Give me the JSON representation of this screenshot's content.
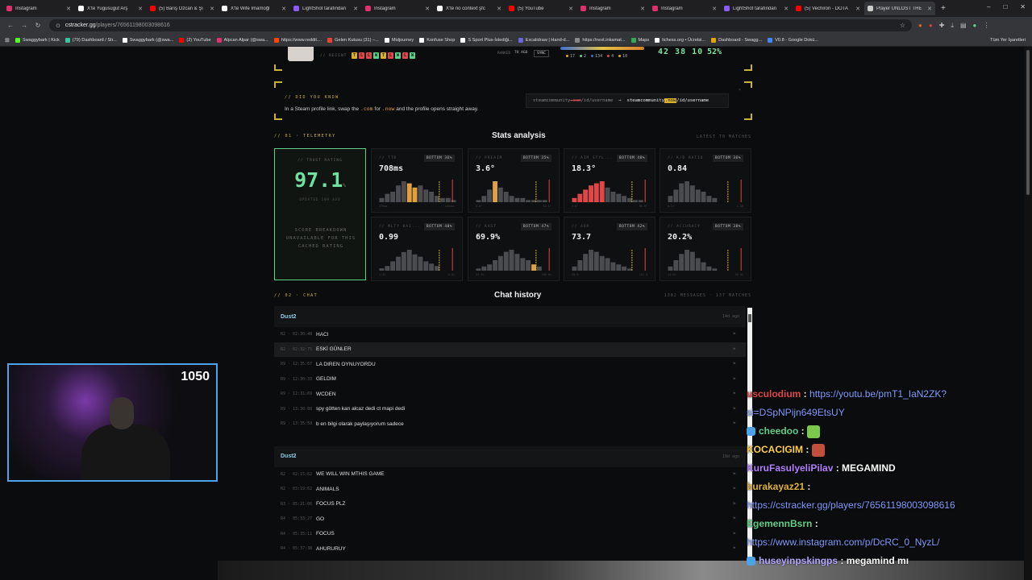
{
  "tabs": [
    {
      "title": "Instagram",
      "color": "#e1306c"
    },
    {
      "title": "X'te Yugusugut Arş",
      "color": "#ffffff"
    },
    {
      "title": "(5) Barış Özcan & Şi",
      "color": "#ff0000"
    },
    {
      "title": "X'te Wife İmamoğl",
      "color": "#ffffff"
    },
    {
      "title": "LightShot tarafından",
      "color": "#8a5cf5"
    },
    {
      "title": "Instagram",
      "color": "#e1306c"
    },
    {
      "title": "X'te no context şfc",
      "color": "#ffffff"
    },
    {
      "title": "(5) YouTube",
      "color": "#ff0000"
    },
    {
      "title": "Instagram",
      "color": "#e1306c"
    },
    {
      "title": "Instagram",
      "color": "#e1306c"
    },
    {
      "title": "LightShot tarafından",
      "color": "#8a5cf5"
    },
    {
      "title": "(5) Vechiron - DOTA",
      "color": "#ff0000"
    },
    {
      "title": "Player UNLOST THE",
      "color": "#cccccc"
    }
  ],
  "window_controls": [
    "–",
    "□",
    "✕"
  ],
  "nav": {
    "back": "←",
    "forward": "→",
    "reload": "↻",
    "lock": "⊙"
  },
  "url": {
    "host": "cstracker.gg",
    "path": "/players/76561198003098616"
  },
  "bookmarks": [
    {
      "label": "Swaggybark | Kick",
      "color": "#53fc18"
    },
    {
      "label": "(79) Dashboard / Str...",
      "color": "#36c5a0"
    },
    {
      "label": "Swaggybark (@swa...",
      "color": "#ffffff"
    },
    {
      "label": "(2) YouTube",
      "color": "#ff0000"
    },
    {
      "label": "Alpcan Alpar (@swa...",
      "color": "#e1306c"
    },
    {
      "label": "https://www.reddit....",
      "color": "#ff4500"
    },
    {
      "label": "Gelen Kutusu (31) –...",
      "color": "#ea4335"
    },
    {
      "label": "Midjourney",
      "color": "#ffffff"
    },
    {
      "label": "Konfuse Shop",
      "color": "#ffffff"
    },
    {
      "label": "S Sport Plus-İstediği...",
      "color": "#ffffff"
    },
    {
      "label": "Excalidraw | Hand-d...",
      "color": "#6965db"
    },
    {
      "label": "https://next.inkamat...",
      "color": "#888888"
    },
    {
      "label": "Maps",
      "color": "#34a853"
    },
    {
      "label": "lichess.org • Ücretsi...",
      "color": "#ffffff"
    },
    {
      "label": "Dashboard - Swagg...",
      "color": "#e2a400"
    },
    {
      "label": "V0.8 - Google Dokü...",
      "color": "#4285f4"
    }
  ],
  "bookmarks_right": "Tüm Yer İşaretleri",
  "profile": {
    "recent_label": "// RECENT",
    "recent": [
      {
        "r": "T",
        "c": "#d9b02a"
      },
      {
        "r": "L",
        "c": "#e04848"
      },
      {
        "r": "L",
        "c": "#e04848"
      },
      {
        "r": "W",
        "c": "#5fd08a"
      },
      {
        "r": "T",
        "c": "#d9b02a"
      },
      {
        "r": "L",
        "c": "#e04848"
      },
      {
        "r": "W",
        "c": "#5fd08a"
      },
      {
        "r": "L",
        "c": "#e04848"
      },
      {
        "r": "W",
        "c": "#5fd08a"
      }
    ],
    "ranked": "RANKED",
    "ago": "7H AGO",
    "sync": "SYNC",
    "map_stats": [
      {
        "v": "17",
        "c": "#d9b02a"
      },
      {
        "v": "2",
        "c": "#5fd08a"
      },
      {
        "v": "134",
        "c": "#3e6fd1"
      },
      {
        "v": "4",
        "c": "#e04848"
      },
      {
        "v": "10",
        "c": "#d9b02a"
      }
    ],
    "kda": "42 38 10",
    "winrate": "52%"
  },
  "did_you_know": {
    "label": "// DID YOU KNOW",
    "text_a": "In a Steam profile link, swap the ",
    "com": ".com",
    "text_b": " for ",
    "now": ".now",
    "text_c": " and the profile opens straight away.",
    "from_a": "steamcommunity",
    "from_b": ".com",
    "from_c": "/id/username",
    "arrow": "→",
    "to_a": "steamcommunity",
    "to_b": ".now",
    "to_c": "/id/username",
    "close": "×"
  },
  "telemetry": {
    "label": "// 01 · TELEMETRY",
    "title": "Stats analysis",
    "right": "LATEST 70 MATCHES"
  },
  "trust": {
    "label": "// TRUST RATING",
    "value": "97.1",
    "unit": "%",
    "updated": "UPDATED 10H AGO",
    "note": "SCORE BREAKDOWN UNAVAILABLE FOR THIS CACHED RATING"
  },
  "stats": [
    {
      "label": "// TTD",
      "badge": "BOTTOM 36%",
      "value": "708ms",
      "lo": "379ms",
      "hi": "1163ms",
      "hist": [
        2,
        4,
        5,
        8,
        10,
        9,
        7,
        8,
        6,
        5,
        3,
        2,
        2,
        1
      ],
      "hl": [
        5,
        6
      ],
      "hlc": "#e0a040"
    },
    {
      "label": "// PREAIM",
      "badge": "BOTTOM 35%",
      "value": "3.6°",
      "lo": "0.0°",
      "hi": "12.1°",
      "hist": [
        1,
        3,
        6,
        10,
        7,
        5,
        3,
        2,
        2,
        1,
        1,
        1,
        1,
        0
      ],
      "hl": [
        3
      ],
      "hlc": "#e0a040"
    },
    {
      "label": "// AIM STYL...",
      "badge": "BOTTOM 40%",
      "value": "18.3°",
      "lo": "3.0°",
      "hi": "38.5°",
      "hist": [
        2,
        4,
        6,
        8,
        9,
        10,
        7,
        5,
        4,
        3,
        2,
        1,
        1,
        0
      ],
      "hl": [
        0,
        1,
        2,
        3,
        4,
        5
      ],
      "hlc": "#e04848"
    },
    {
      "label": "// K/D RATIO",
      "badge": "BOTTOM 36%",
      "value": "0.84",
      "lo": "0.27",
      "hi": "2.50",
      "hist": [
        3,
        6,
        9,
        10,
        8,
        6,
        5,
        3,
        2,
        0,
        0,
        0,
        0,
        0
      ],
      "hl": [],
      "hlc": "#e04848"
    },
    {
      "label": "// MLTY KAI...",
      "badge": "BOTTOM 40%",
      "value": "0.99",
      "lo": "1.32",
      "hi": "2.51",
      "hist": [
        1,
        2,
        4,
        6,
        8,
        9,
        7,
        6,
        4,
        3,
        2,
        0,
        0,
        0
      ],
      "hl": [],
      "hlc": "#e04848"
    },
    {
      "label": "// KAST",
      "badge": "BOTTOM 47%",
      "value": "69.9%",
      "lo": "33.3%",
      "hi": "100.0%",
      "hist": [
        1,
        2,
        3,
        5,
        7,
        9,
        10,
        8,
        6,
        5,
        3,
        2,
        0,
        0
      ],
      "hl": [
        10
      ],
      "hlc": "#e0a040"
    },
    {
      "label": "// ADR",
      "badge": "BOTTOM 42%",
      "value": "73.7",
      "lo": "29.5",
      "hi": "142.3",
      "hist": [
        2,
        5,
        8,
        10,
        9,
        7,
        6,
        4,
        3,
        2,
        1,
        0,
        0,
        0
      ],
      "hl": [],
      "hlc": "#e04848"
    },
    {
      "label": "// ACCURACY",
      "badge": "BOTTOM 38%",
      "value": "20.2%",
      "lo": "11.0%",
      "hi": "38.0%",
      "hist": [
        2,
        5,
        8,
        10,
        9,
        6,
        4,
        2,
        1,
        0,
        0,
        0,
        0,
        0
      ],
      "hl": [],
      "hlc": "#e04848"
    }
  ],
  "chat": {
    "label": "// 02 · CHAT",
    "title": "Chat history",
    "right": "1382 MESSAGES · 137 MATCHES",
    "groups": [
      {
        "map": "Dust2",
        "ago": "14d ago",
        "messages": [
          {
            "ts": "R2 · 02:30:48",
            "text": "HACI"
          },
          {
            "ts": "R2 · 02:32:75",
            "text": "ESKİ GÜNLER"
          },
          {
            "ts": "R9 · 12:35:67",
            "text": "LA DIREN OYNUYORDU"
          },
          {
            "ts": "R9 · 12:30:33",
            "text": "GELDIM"
          },
          {
            "ts": "R9 · 12:31:69",
            "text": "WCDEN"
          },
          {
            "ts": "R9 · 13:30:88",
            "text": "spy götten kan alcaz dedi ct mapi dedi"
          },
          {
            "ts": "R9 · 13:35:59",
            "text": "b en bilgi olarak paylaşıyorum sadece"
          }
        ]
      },
      {
        "map": "Dust2",
        "ago": "19d ago",
        "messages": [
          {
            "ts": "R2 · 02:15:62",
            "text": "WE WILL WIN MTHIS GAME"
          },
          {
            "ts": "R2 · 03:19:62",
            "text": "ANIMALS"
          },
          {
            "ts": "R3 · 05:21:06",
            "text": "FOCUS PLZ"
          },
          {
            "ts": "R4 · 05:33:27",
            "text": "GO"
          },
          {
            "ts": "R4 · 05:35:11",
            "text": "FOCUS"
          },
          {
            "ts": "R4 · 05:37:38",
            "text": "AHURURUY"
          }
        ]
      }
    ]
  },
  "webcam": {
    "score": "1050"
  },
  "stream_chat": [
    {
      "user": "usculodium",
      "color": "#e04848",
      "sep": " : ",
      "text": "https://youtu.be/pmT1_IaN2ZK?",
      "link": true
    },
    {
      "user": "",
      "color": "#7f9cff",
      "sep": "",
      "text": "si=DSpNPijn649EtsUY",
      "link": true
    },
    {
      "user": "cheedoo",
      "color": "#5fd08a",
      "sep": " : ",
      "text": "",
      "emote": "#7ac94a",
      "badge": true
    },
    {
      "user": "KOCACIGIM",
      "color": "#ffd24a",
      "sep": " : ",
      "text": "",
      "emote": "#c0503a"
    },
    {
      "user": "KuruFasulyeliPilav",
      "color": "#b27fff",
      "sep": " : ",
      "text": "MEGAMIND"
    },
    {
      "user": "burakayaz21",
      "color": "#e0b43a",
      "sep": " :",
      "text": ""
    },
    {
      "user": "",
      "color": "#7f9cff",
      "sep": "",
      "text": "https://cstracker.gg/players/76561198003098616",
      "link": true
    },
    {
      "user": "EgemennBsrn",
      "color": "#5fd08a",
      "sep": " :",
      "text": ""
    },
    {
      "user": "",
      "color": "#7f9cff",
      "sep": "",
      "text": "https://www.instagram.com/p/DcRC_0_NyzL/",
      "link": true
    },
    {
      "user": "huseyinpskingps",
      "color": "#b2a6ff",
      "sep": " : ",
      "text": "megamind mı",
      "badge": true
    }
  ]
}
